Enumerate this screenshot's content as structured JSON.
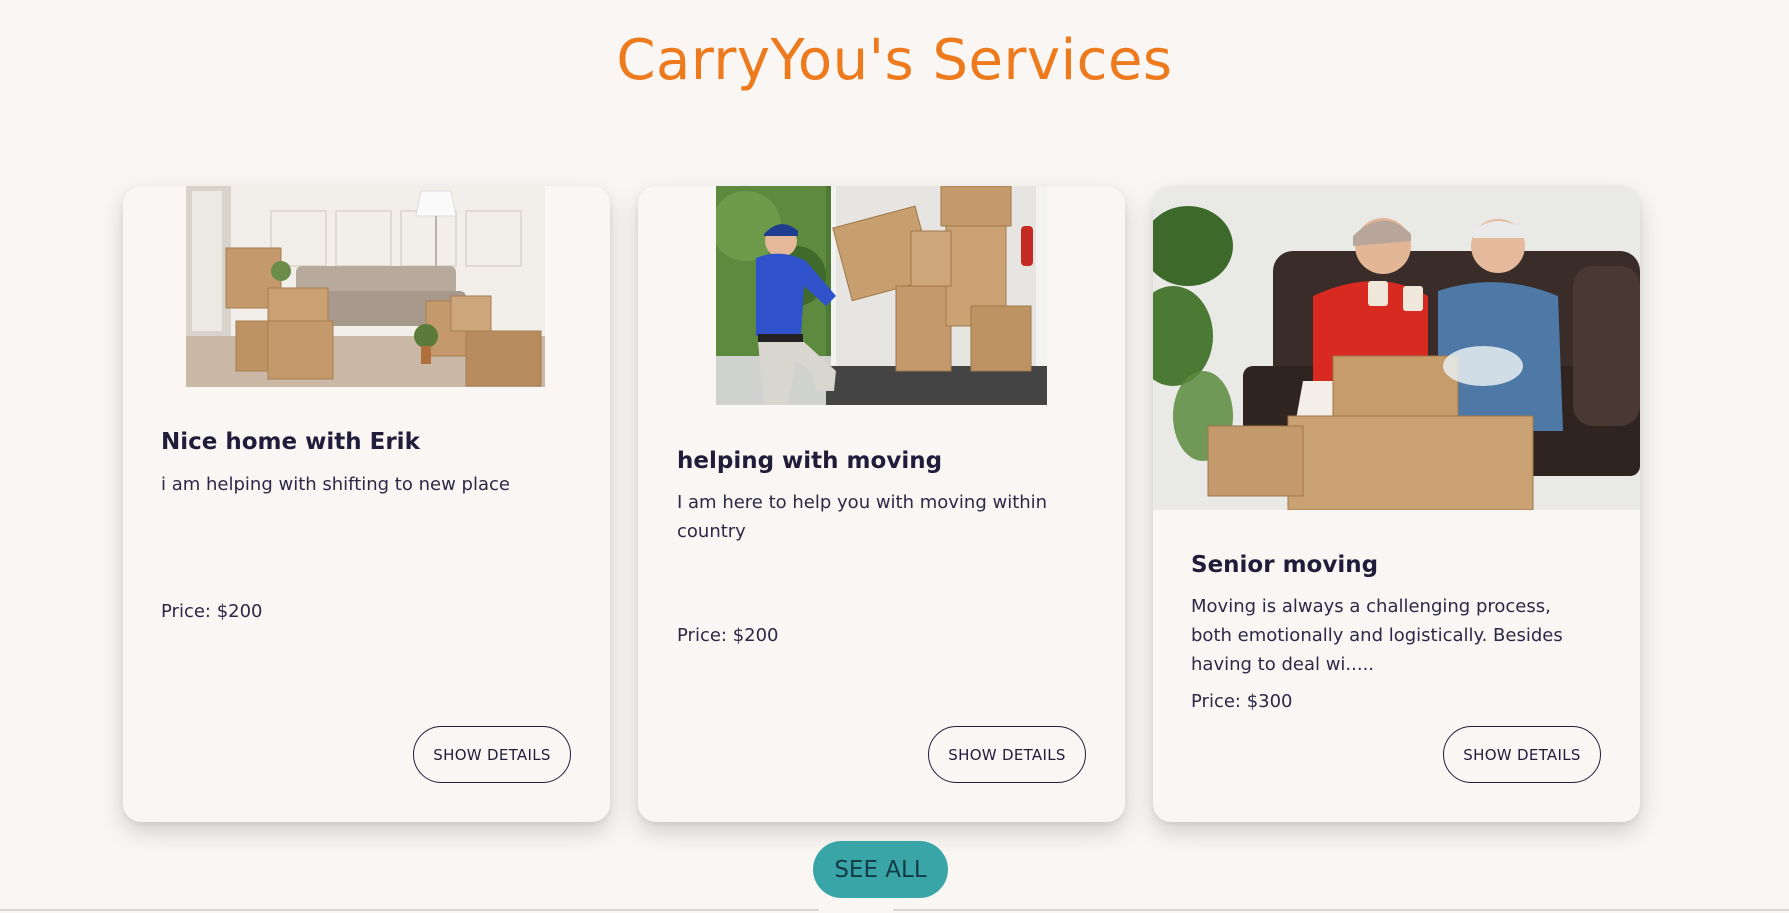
{
  "page": {
    "title": "CarryYou's Services"
  },
  "services": [
    {
      "title": "Nice home with Erik",
      "description": "i am helping with shifting to new place",
      "price": "Price: $200",
      "button_label": "SHOW DETAILS",
      "image_name": "living-room-moving-boxes-photo"
    },
    {
      "title": "helping with moving",
      "description": "I am here to help you with moving within country",
      "price": "Price: $200",
      "button_label": "SHOW DETAILS",
      "image_name": "mover-loading-truck-photo"
    },
    {
      "title": "Senior moving",
      "description": "Moving is always a challenging process, both emotionally and logistically. Besides having to deal wi.....",
      "price": "Price: $300",
      "button_label": "SHOW DETAILS",
      "image_name": "senior-couple-on-sofa-photo"
    }
  ],
  "see_all": {
    "label": "SEE ALL"
  },
  "colors": {
    "title_orange": "#ee7a1e",
    "text_navy": "#1f1d3a",
    "see_all_teal": "#3aa5a6",
    "background": "#f9f6f4"
  }
}
